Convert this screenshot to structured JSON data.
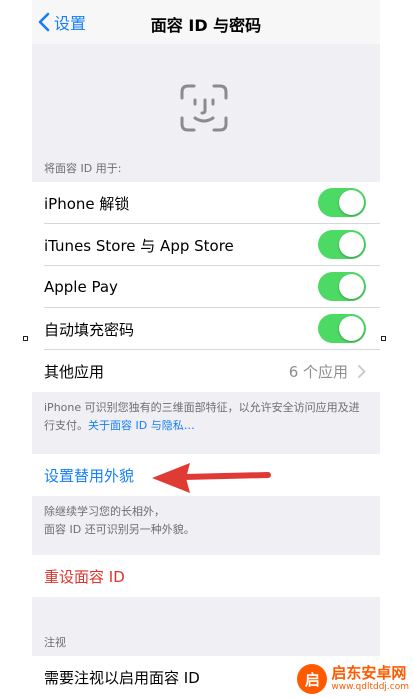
{
  "nav": {
    "back_label": "设置",
    "title": "面容 ID 与密码"
  },
  "use_for": {
    "header": "将面容 ID 用于:",
    "rows": [
      {
        "label": "iPhone 解锁",
        "on": true
      },
      {
        "label": "iTunes Store 与 App Store",
        "on": true
      },
      {
        "label": "Apple Pay",
        "on": true
      },
      {
        "label": "自动填充密码",
        "on": true
      }
    ],
    "other_apps": {
      "label": "其他应用",
      "value": "6 个应用"
    }
  },
  "footer": {
    "text": "iPhone 可识别您独有的三维面部特征，以允许安全访问应用及进行支付。",
    "link": "关于面容 ID 与隐私…"
  },
  "alt_appearance": {
    "label": "设置替用外貌",
    "note_line1": "除继续学习您的长相外，",
    "note_line2": "面容 ID 还可识别另一种外貌。"
  },
  "reset": {
    "label": "重设面容 ID"
  },
  "attention": {
    "header": "注视",
    "row_label": "需要注视以启用面容 ID"
  },
  "watermark": {
    "logo_char": "启",
    "name": "启东安卓网",
    "url": "www.qdltddj.com"
  },
  "colors": {
    "accent": "#147efb",
    "toggle_on": "#4cd964",
    "destructive": "#e0322a",
    "annotation_arrow": "#e03a35",
    "watermark": "#ff5a00"
  }
}
